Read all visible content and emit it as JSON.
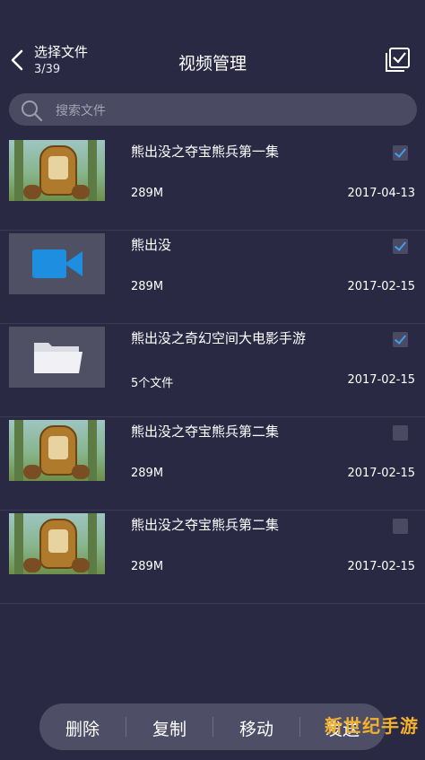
{
  "header": {
    "select_title": "选择文件",
    "count": "3/39",
    "title": "视频管理"
  },
  "search": {
    "placeholder": "搜索文件"
  },
  "items": [
    {
      "name": "熊出没之夺宝熊兵第一集",
      "size": "289M",
      "date": "2017-04-13",
      "thumb": "poster",
      "checked": true
    },
    {
      "name": "熊出没",
      "size": "289M",
      "date": "2017-02-15",
      "thumb": "video-icon",
      "checked": true
    },
    {
      "name": "熊出没之奇幻空间大电影手游",
      "size": "5个文件",
      "date": "2017-02-15",
      "thumb": "folder-icon",
      "checked": true
    },
    {
      "name": "熊出没之夺宝熊兵第二集",
      "size": "289M",
      "date": "2017-02-15",
      "thumb": "poster",
      "checked": false
    },
    {
      "name": "熊出没之夺宝熊兵第二集",
      "size": "289M",
      "date": "2017-02-15",
      "thumb": "poster",
      "checked": false
    }
  ],
  "toolbar": {
    "delete": "删除",
    "copy": "复制",
    "move": "移动",
    "send": "发送"
  },
  "watermark": "新世纪手游",
  "colors": {
    "background": "#2a2943",
    "accent": "#3d9df2",
    "video_icon": "#1e8fe0"
  }
}
